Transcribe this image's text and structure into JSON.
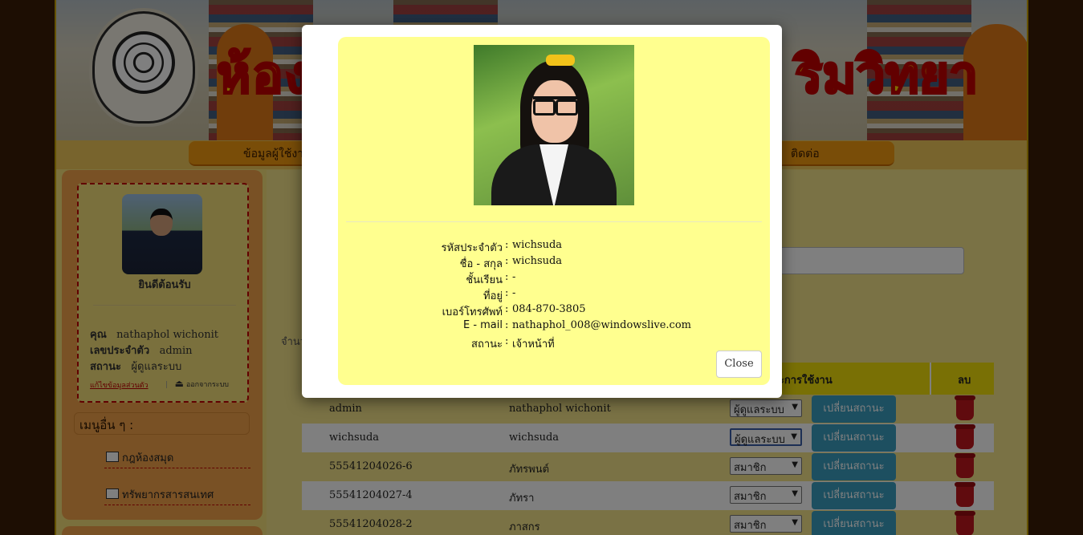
{
  "banner": {
    "title_left": "ห้อง",
    "title_right": "ริมวิทยา"
  },
  "nav": {
    "item1": "ข้อมูลผู้ใช้งา",
    "item_contact": "ติดต่อ"
  },
  "user": {
    "welcome": "ยินดีต้อนรับ",
    "name_label": "คุณ",
    "name_value": "nathaphol wichonit",
    "id_label": "เลขประจำตัว",
    "id_value": "admin",
    "status_label": "สถานะ",
    "status_value": "ผู้ดูแลระบบ",
    "edit_link": "แก้ไขข้อมูลส่วนตัว",
    "separator": "|",
    "logout": "ออกจากระบบ"
  },
  "menu": {
    "header": "เมนูอื่น ๆ :",
    "items": [
      "กฎห้องสมุด",
      "ทรัพยากรสารสนเทศ"
    ]
  },
  "main": {
    "count_label": "จำนว"
  },
  "table": {
    "headers": {
      "status_action": "นะการใช้งาน",
      "delete": "ลบ"
    },
    "rows": [
      {
        "id": "admin",
        "name": "nathaphol wichonit",
        "role": "ผู้ดูแลระบบ",
        "action": "เปลี่ยนสถานะ"
      },
      {
        "id": "wichsuda",
        "name": "wichsuda",
        "role": "ผู้ดูแลระบบ",
        "action": "เปลี่ยนสถานะ"
      },
      {
        "id": "55541204026-6",
        "name": "ภัทรพนต์",
        "role": "สมาชิก",
        "action": "เปลี่ยนสถานะ"
      },
      {
        "id": "55541204027-4",
        "name": "ภัทรา",
        "role": "สมาชิก",
        "action": "เปลี่ยนสถานะ"
      },
      {
        "id": "55541204028-2",
        "name": "ภาสกร",
        "role": "สมาชิก",
        "action": "เปลี่ยนสถานะ"
      }
    ]
  },
  "modal": {
    "fields": [
      {
        "label": "รหัสประจำตัว",
        "sep": ":",
        "value": "wichsuda"
      },
      {
        "label": "ชื่อ - สกุล",
        "sep": ":",
        "value": "wichsuda"
      },
      {
        "label": "ชั้นเรียน",
        "sep": ":",
        "value": "-"
      },
      {
        "label": "ที่อยู่",
        "sep": ":",
        "value": "-"
      },
      {
        "label": "เบอร์โทรศัพท์",
        "sep": ":",
        "value": "084-870-3805"
      },
      {
        "label": "E - mail",
        "sep": ":",
        "value": "nathaphol_008@windowslive.com"
      },
      {
        "label": "สถานะ",
        "sep": ":",
        "value": "เจ้าหน้าที่"
      }
    ],
    "close_label": "Close"
  }
}
